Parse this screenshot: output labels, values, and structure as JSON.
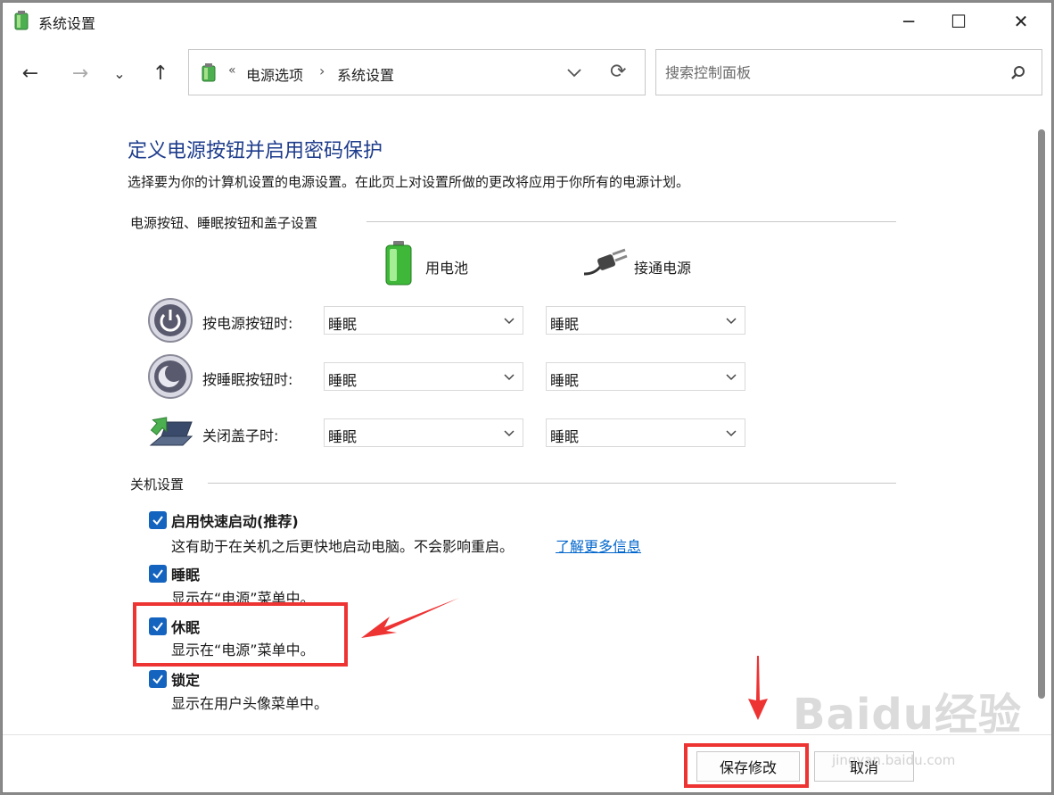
{
  "window": {
    "title": "系统设置",
    "controls": {
      "minimize": "─",
      "maximize": "☐",
      "close": "✕"
    }
  },
  "nav": {
    "back": "←",
    "forward": "→",
    "recent": "⌄",
    "up": "↑",
    "refresh": "⟳"
  },
  "address": {
    "overflow": "«",
    "breadcrumbs": [
      "电源选项",
      "系统设置"
    ],
    "separator": "›"
  },
  "search": {
    "placeholder": "搜索控制面板"
  },
  "page": {
    "heading": "定义电源按钮并启用密码保护",
    "description": "选择要为你的计算机设置的电源设置。在此页上对设置所做的更改将应用于你所有的电源计划。"
  },
  "buttons_section": {
    "label": "电源按钮、睡眠按钮和盖子设置",
    "columns": [
      "用电池",
      "接通电源"
    ],
    "rows": [
      {
        "label": "按电源按钮时:",
        "battery": "睡眠",
        "plugged": "睡眠",
        "icon": "power-button-icon"
      },
      {
        "label": "按睡眠按钮时:",
        "battery": "睡眠",
        "plugged": "睡眠",
        "icon": "sleep-button-icon"
      },
      {
        "label": "关闭盖子时:",
        "battery": "睡眠",
        "plugged": "睡眠",
        "icon": "laptop-lid-icon"
      }
    ]
  },
  "shutdown_section": {
    "label": "关机设置",
    "options": [
      {
        "title": "启用快速启动(推荐)",
        "desc": "这有助于在关机之后更快地启动电脑。不会影响重启。",
        "link": "了解更多信息",
        "checked": true
      },
      {
        "title": "睡眠",
        "desc": "显示在“电源”菜单中。",
        "checked": true
      },
      {
        "title": "休眠",
        "desc": "显示在“电源”菜单中。",
        "checked": true
      },
      {
        "title": "锁定",
        "desc": "显示在用户头像菜单中。",
        "checked": true
      }
    ]
  },
  "footer": {
    "save": "保存修改",
    "cancel": "取消"
  },
  "watermark": {
    "brand": "Baidu经验",
    "url": "jingyan.baidu.com"
  },
  "colors": {
    "heading": "#1e3c8c",
    "checkbox": "#1463be",
    "link": "#0066cc",
    "annotation": "#ee3333"
  }
}
